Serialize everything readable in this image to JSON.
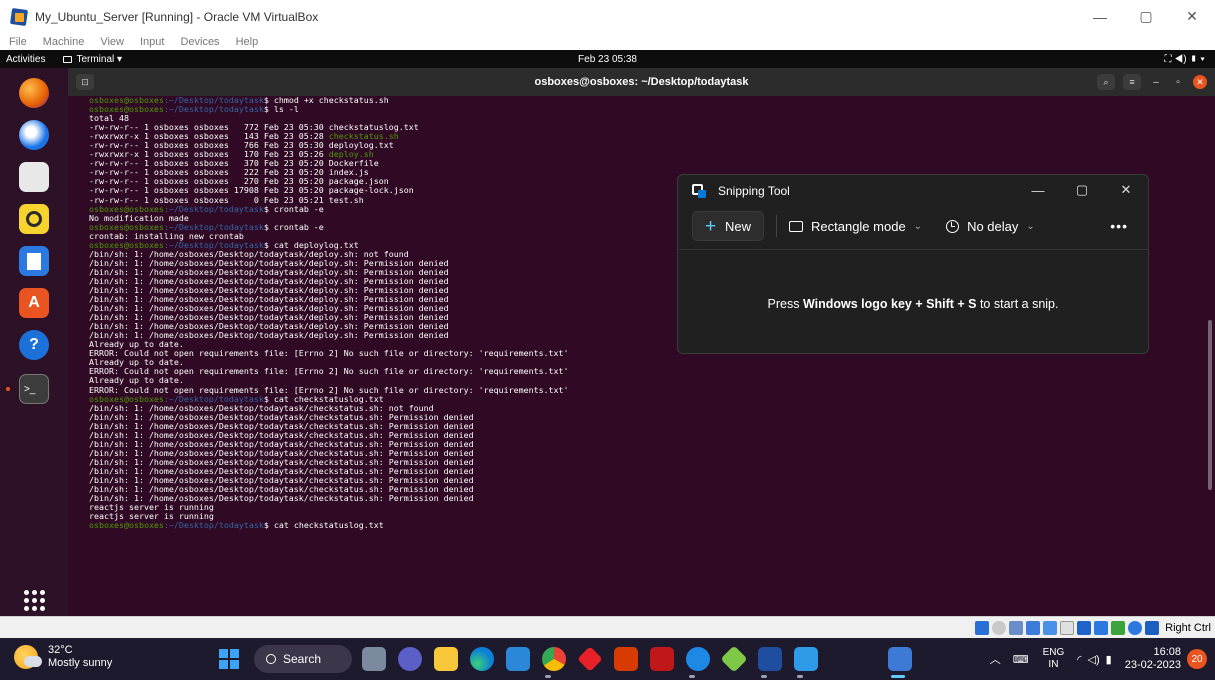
{
  "window": {
    "title": "My_Ubuntu_Server [Running] - Oracle VM VirtualBox",
    "controls": {
      "minimize": "—",
      "restore": "▢",
      "close": "✕"
    }
  },
  "menubar": [
    "File",
    "Machine",
    "View",
    "Input",
    "Devices",
    "Help"
  ],
  "ubuntu_topbar": {
    "activities": "Activities",
    "app_menu": "Terminal ▾",
    "clock": "Feb 23 05:38",
    "tray": "⛶ ◀) ▮ ▾"
  },
  "terminal": {
    "title": "osboxes@osboxes: ~/Desktop/todaytask",
    "lines": [
      {
        "prompt": true,
        "cmd": "chmod +x checkstatus.sh"
      },
      {
        "prompt": true,
        "cmd": "ls -l"
      },
      {
        "text": "total 48"
      },
      {
        "text": "-rw-rw-r-- 1 osboxes osboxes   772 Feb 23 05:30 ",
        "file": "checkstatuslog.txt"
      },
      {
        "text": "-rwxrwxr-x 1 osboxes osboxes   143 Feb 23 05:28 ",
        "file": "checkstatus.sh",
        "exec": true
      },
      {
        "text": "-rw-rw-r-- 1 osboxes osboxes   766 Feb 23 05:30 ",
        "file": "deploylog.txt"
      },
      {
        "text": "-rwxrwxr-x 1 osboxes osboxes   170 Feb 23 05:26 ",
        "file": "deploy.sh",
        "exec": true
      },
      {
        "text": "-rw-rw-r-- 1 osboxes osboxes   370 Feb 23 05:20 ",
        "file": "Dockerfile"
      },
      {
        "text": "-rw-rw-r-- 1 osboxes osboxes   222 Feb 23 05:20 ",
        "file": "index.js"
      },
      {
        "text": "-rw-rw-r-- 1 osboxes osboxes   270 Feb 23 05:20 ",
        "file": "package.json"
      },
      {
        "text": "-rw-rw-r-- 1 osboxes osboxes 17908 Feb 23 05:20 ",
        "file": "package-lock.json"
      },
      {
        "text": "-rw-rw-r-- 1 osboxes osboxes     0 Feb 23 05:21 ",
        "file": "test.sh"
      },
      {
        "prompt": true,
        "cmd": "crontab -e"
      },
      {
        "text": "No modification made"
      },
      {
        "prompt": true,
        "cmd": "crontab -e"
      },
      {
        "text": "crontab: installing new crontab"
      },
      {
        "prompt": true,
        "cmd": "cat deploylog.txt"
      },
      {
        "text": "/bin/sh: 1: /home/osboxes/Desktop/todaytask/deploy.sh: not found"
      },
      {
        "text": "/bin/sh: 1: /home/osboxes/Desktop/todaytask/deploy.sh: Permission denied"
      },
      {
        "text": "/bin/sh: 1: /home/osboxes/Desktop/todaytask/deploy.sh: Permission denied"
      },
      {
        "text": "/bin/sh: 1: /home/osboxes/Desktop/todaytask/deploy.sh: Permission denied"
      },
      {
        "text": "/bin/sh: 1: /home/osboxes/Desktop/todaytask/deploy.sh: Permission denied"
      },
      {
        "text": "/bin/sh: 1: /home/osboxes/Desktop/todaytask/deploy.sh: Permission denied"
      },
      {
        "text": "/bin/sh: 1: /home/osboxes/Desktop/todaytask/deploy.sh: Permission denied"
      },
      {
        "text": "/bin/sh: 1: /home/osboxes/Desktop/todaytask/deploy.sh: Permission denied"
      },
      {
        "text": "/bin/sh: 1: /home/osboxes/Desktop/todaytask/deploy.sh: Permission denied"
      },
      {
        "text": "/bin/sh: 1: /home/osboxes/Desktop/todaytask/deploy.sh: Permission denied"
      },
      {
        "text": "Already up to date."
      },
      {
        "text": "ERROR: Could not open requirements file: [Errno 2] No such file or directory: 'requirements.txt'"
      },
      {
        "text": "Already up to date."
      },
      {
        "text": "ERROR: Could not open requirements file: [Errno 2] No such file or directory: 'requirements.txt'"
      },
      {
        "text": "Already up to date."
      },
      {
        "text": "ERROR: Could not open requirements file: [Errno 2] No such file or directory: 'requirements.txt'"
      },
      {
        "prompt": true,
        "cmd": "cat checkstatuslog.txt"
      },
      {
        "text": "/bin/sh: 1: /home/osboxes/Desktop/todaytask/checkstatus.sh: not found"
      },
      {
        "text": "/bin/sh: 1: /home/osboxes/Desktop/todaytask/checkstatus.sh: Permission denied"
      },
      {
        "text": "/bin/sh: 1: /home/osboxes/Desktop/todaytask/checkstatus.sh: Permission denied"
      },
      {
        "text": "/bin/sh: 1: /home/osboxes/Desktop/todaytask/checkstatus.sh: Permission denied"
      },
      {
        "text": "/bin/sh: 1: /home/osboxes/Desktop/todaytask/checkstatus.sh: Permission denied"
      },
      {
        "text": "/bin/sh: 1: /home/osboxes/Desktop/todaytask/checkstatus.sh: Permission denied"
      },
      {
        "text": "/bin/sh: 1: /home/osboxes/Desktop/todaytask/checkstatus.sh: Permission denied"
      },
      {
        "text": "/bin/sh: 1: /home/osboxes/Desktop/todaytask/checkstatus.sh: Permission denied"
      },
      {
        "text": "/bin/sh: 1: /home/osboxes/Desktop/todaytask/checkstatus.sh: Permission denied"
      },
      {
        "text": "/bin/sh: 1: /home/osboxes/Desktop/todaytask/checkstatus.sh: Permission denied"
      },
      {
        "text": "/bin/sh: 1: /home/osboxes/Desktop/todaytask/checkstatus.sh: Permission denied"
      },
      {
        "text": "reactjs server is running"
      },
      {
        "text": "reactjs server is running"
      },
      {
        "prompt": true,
        "cmd": "cat checkstatuslog.txt"
      }
    ],
    "prompt_user": "osboxes@osboxes",
    "prompt_path": ":~/Desktop/todaytask",
    "prompt_symbol": "$ "
  },
  "snipping_tool": {
    "title": "Snipping Tool",
    "new_label": "New",
    "mode_label": "Rectangle mode",
    "delay_label": "No delay",
    "more": "•••",
    "hint_pre": "Press ",
    "hint_bold": "Windows logo key + Shift + S",
    "hint_post": " to start a snip."
  },
  "vbox_status": {
    "host_key": "Right Ctrl"
  },
  "taskbar": {
    "weather_temp": "32°C",
    "weather_desc": "Mostly sunny",
    "search_label": "Search",
    "lang_top": "ENG",
    "lang_bottom": "IN",
    "time": "16:08",
    "date": "23-02-2023",
    "notifications": "20"
  },
  "colors": {
    "terminal_bg": "#300a24",
    "prompt_user": "#4e9a06",
    "prompt_path": "#3465a4",
    "ubuntu_orange": "#e95420",
    "snip_accent": "#60cdff"
  }
}
